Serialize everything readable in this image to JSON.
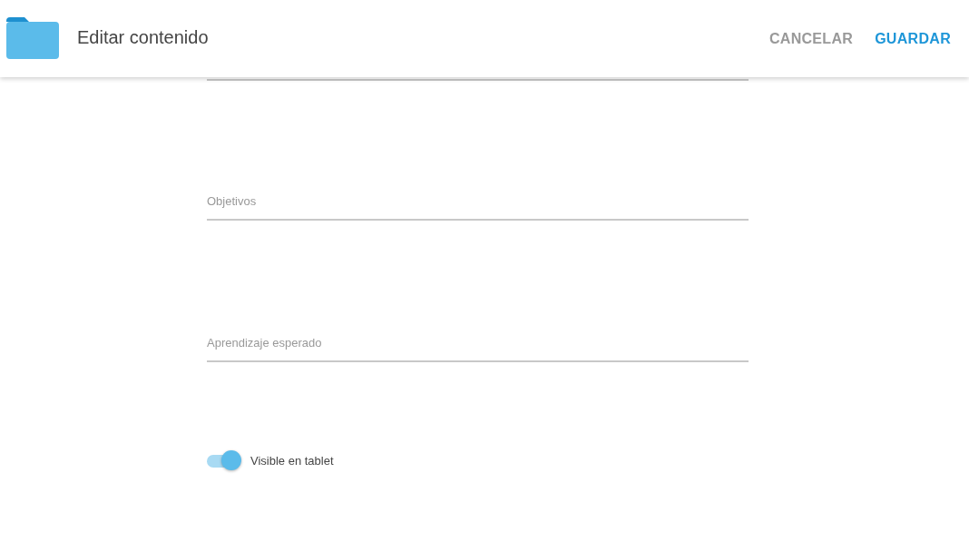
{
  "header": {
    "title": "Editar contenido",
    "actions": [
      {
        "label": "CANCELAR",
        "kind": "secondary"
      },
      {
        "label": "GUARDAR",
        "kind": "primary"
      }
    ]
  },
  "fields": [
    {
      "placeholder": "Objetivos"
    },
    {
      "placeholder": "Aprendizaje esperado"
    }
  ],
  "toggle": {
    "label": "Visible en tablet",
    "on": true
  }
}
